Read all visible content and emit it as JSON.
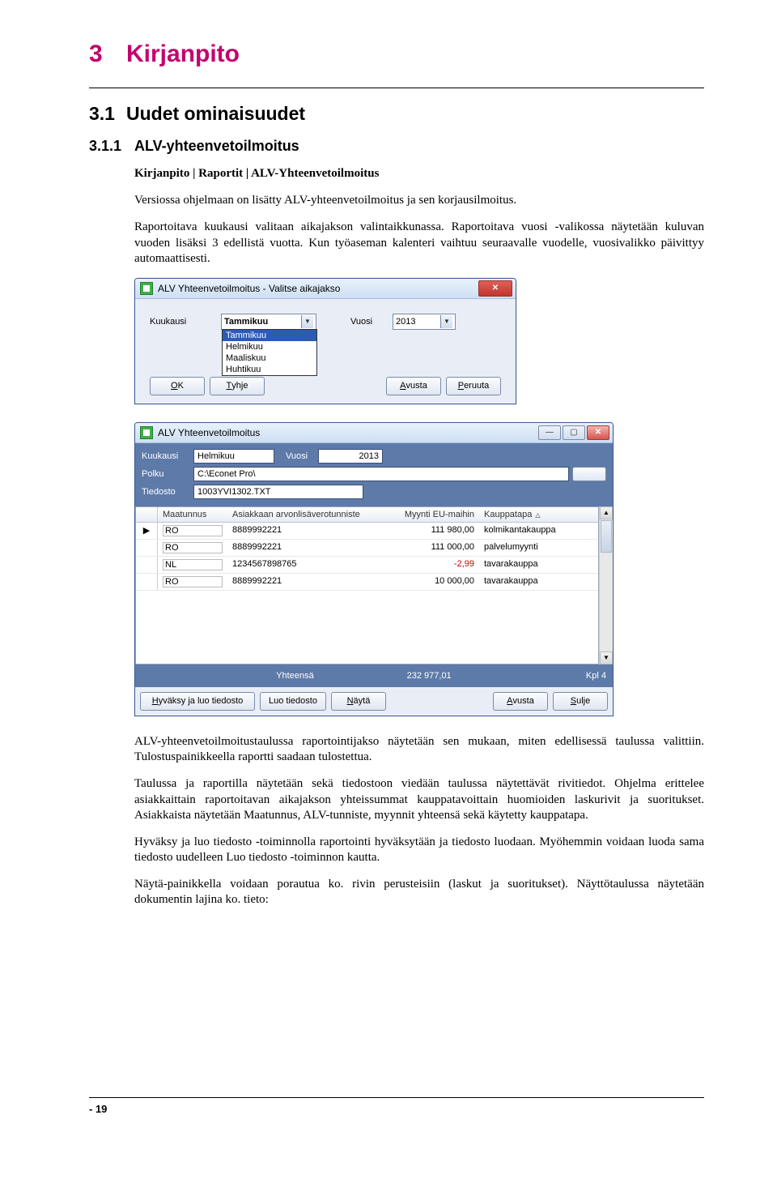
{
  "headings": {
    "h1_num": "3",
    "h1_text": "Kirjanpito",
    "h2_num": "3.1",
    "h2_text": "Uudet ominaisuudet",
    "h3_num": "3.1.1",
    "h3_text": "ALV-yhteenvetoilmoitus"
  },
  "path": "Kirjanpito | Raportit | ALV-Yhteenvetoilmoitus",
  "intro": "Versiossa ohjelmaan on lisätty ALV-yhteenvetoilmoitus ja sen korjausilmoitus.",
  "para1": "Raportoitava kuukausi valitaan aikajakson valintaikkunassa. Raportoitava vuosi -valikossa näytetään kuluvan vuoden lisäksi 3 edellistä vuotta. Kun työaseman kalenteri vaihtuu seuraavalle vuodelle, vuosivalikko päivittyy automaattisesti.",
  "dlg1": {
    "title": "ALV Yhteenvetoilmoitus - Valitse aikajakso",
    "lbl_month": "Kuukausi",
    "lbl_year": "Vuosi",
    "month_value": "Tammikuu",
    "year_value": "2013",
    "opts": [
      "Tammikuu",
      "Helmikuu",
      "Maaliskuu",
      "Huhtikuu"
    ],
    "btn_ok": "OK",
    "btn_clear": "Tyhjennä",
    "btn_help": "Avusta",
    "btn_cancel": "Peruuta"
  },
  "dlg2": {
    "title": "ALV Yhteenvetoilmoitus",
    "lbl_month": "Kuukausi",
    "val_month": "Helmikuu",
    "lbl_year": "Vuosi",
    "val_year": "2013",
    "lbl_path": "Polku",
    "val_path": "C:\\Econet Pro\\",
    "lbl_file": "Tiedosto",
    "val_file": "1003YVI1302.TXT",
    "cols": {
      "c1": "Maatunnus",
      "c2": "Asiakkaan arvonlisäverotunniste",
      "c3": "Myynti EU-maihin",
      "c4": "Kauppatapa"
    },
    "rows": [
      {
        "sel": "▶",
        "c1": "RO",
        "c2": "8889992221",
        "c3": "111 980,00",
        "c4": "kolmikantakauppa"
      },
      {
        "sel": "",
        "c1": "RO",
        "c2": "8889992221",
        "c3": "111 000,00",
        "c4": "palvelumyynti"
      },
      {
        "sel": "",
        "c1": "NL",
        "c2": "1234567898765",
        "c3": "-2,99",
        "c4": "tavarakauppa",
        "neg": true
      },
      {
        "sel": "",
        "c1": "RO",
        "c2": "8889992221",
        "c3": "10 000,00",
        "c4": "tavarakauppa"
      }
    ],
    "totals_lbl": "Yhteensä",
    "totals_val": "232 977,01",
    "count_lbl": "Kpl",
    "count_val": "4",
    "btn_approve": "Hyväksy ja luo tiedosto",
    "btn_create": "Luo tiedosto",
    "btn_show": "Näytä",
    "btn_help": "Avusta",
    "btn_close": "Sulje"
  },
  "para2": "ALV-yhteenvetoilmoitustaulussa raportointijakso näytetään sen mukaan, miten edellisessä taulussa valittiin. Tulostuspainikkeella raportti saadaan tulostettua.",
  "para3": "Taulussa ja raportilla näytetään sekä tiedostoon viedään taulussa näytettävät rivitiedot. Ohjelma erittelee asiakkaittain raportoitavan aikajakson yhteissummat kauppatavoittain huomioiden laskurivit ja suoritukset. Asiakkaista näytetään Maatunnus, ALV-tunniste, myynnit yhteensä sekä käytetty kauppatapa.",
  "para4": "Hyväksy ja luo tiedosto -toiminnolla raportointi hyväksytään ja tiedosto luodaan. Myöhemmin voidaan luoda sama tiedosto uudelleen Luo tiedosto -toiminnon kautta.",
  "para5": "Näytä-painikkella voidaan porautua ko. rivin perusteisiin (laskut ja suoritukset). Näyttötaulussa näytetään dokumentin lajina ko. tieto:",
  "footer": "- 19"
}
